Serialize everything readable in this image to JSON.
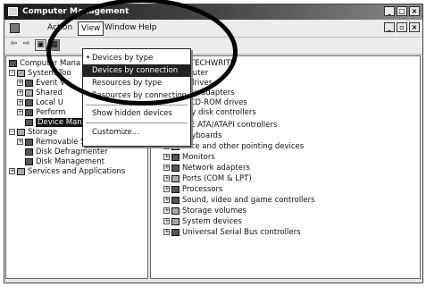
{
  "window": {
    "title": "Computer Management"
  },
  "menubar": {
    "action": "Action",
    "view": "View",
    "window": "Window",
    "help": "Help"
  },
  "view_menu": {
    "items": [
      {
        "label": "Devices by type",
        "checked": true
      },
      {
        "label": "Devices by connection",
        "highlighted": true
      },
      {
        "label": "Resources by type"
      },
      {
        "label": "Resources by connection"
      },
      {
        "label": "Show hidden devices"
      },
      {
        "label": "Customize..."
      }
    ]
  },
  "left_tree": {
    "root": "Computer Mana",
    "system_tools": "System Too",
    "event_viewer": "Event V",
    "shared": "Shared",
    "local_users": "Local U",
    "performance": "Perform",
    "device_manager": "Device Manager",
    "storage": "Storage",
    "removable_storage": "Removable Storage",
    "disk_defragmenter": "Disk Defragmenter",
    "disk_management": "Disk Management",
    "services": "Services and Applications"
  },
  "right_tree": {
    "computer_name": "QMA-TECHWRITR",
    "items": [
      "Computer",
      "Disk drives",
      "Display adapters",
      "DVD/CD-ROM drives",
      "Floppy disk controllers",
      "IDE ATA/ATAPI controllers",
      "Keyboards",
      "Mice and other pointing devices",
      "Monitors",
      "Network adapters",
      "Ports (COM & LPT)",
      "Processors",
      "Sound, video and game controllers",
      "Storage volumes",
      "System devices",
      "Universal Serial Bus controllers"
    ]
  }
}
